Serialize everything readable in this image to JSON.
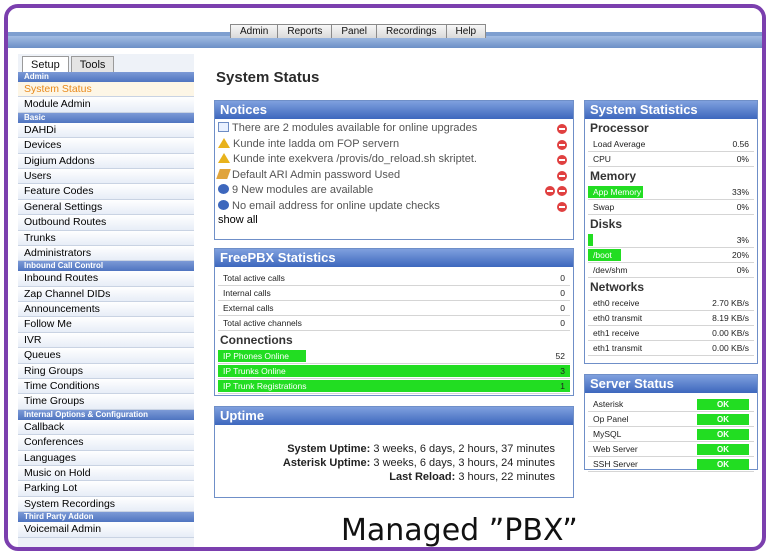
{
  "topnav": {
    "tabs": [
      "Admin",
      "Reports",
      "Panel",
      "Recordings",
      "Help"
    ]
  },
  "sidebar": {
    "tabs": [
      "Setup",
      "Tools"
    ],
    "sections": [
      {
        "header": "Admin",
        "items": [
          "System Status",
          "Module Admin"
        ]
      },
      {
        "header": "Basic",
        "items": [
          "DAHDi",
          "Devices",
          "Digium Addons",
          "Users",
          "Feature Codes",
          "General Settings",
          "Outbound Routes",
          "Trunks",
          "Administrators"
        ]
      },
      {
        "header": "Inbound Call Control",
        "items": [
          "Inbound Routes",
          "Zap Channel DIDs",
          "Announcements",
          "Follow Me",
          "IVR",
          "Queues",
          "Ring Groups",
          "Time Conditions",
          "Time Groups"
        ]
      },
      {
        "header": "Internal Options & Configuration",
        "items": [
          "Callback",
          "Conferences",
          "Languages",
          "Music on Hold",
          "Parking Lot",
          "System Recordings"
        ]
      },
      {
        "header": "Third Party Addon",
        "items": [
          "Voicemail Admin"
        ]
      }
    ]
  },
  "main": {
    "title": "System Status"
  },
  "notices": {
    "title": "Notices",
    "items": [
      {
        "icon": "update-box-icon",
        "text": "There are 2 modules available for online upgrades"
      },
      {
        "icon": "warning-icon",
        "text": "Kunde inte ladda om FOP servern"
      },
      {
        "icon": "warning-icon",
        "text": "Kunde inte exekvera /provis/do_reload.sh skriptet."
      },
      {
        "icon": "pencil-icon",
        "text": "Default ARI Admin password Used"
      },
      {
        "icon": "info-icon",
        "text": "9 New modules are available"
      },
      {
        "icon": "info-icon",
        "text": "No email address for online update checks"
      }
    ],
    "show_all": "show all"
  },
  "freepbx": {
    "title": "FreePBX Statistics",
    "rows": [
      {
        "label": "Total active calls",
        "value": "0"
      },
      {
        "label": "Internal calls",
        "value": "0"
      },
      {
        "label": "External calls",
        "value": "0"
      },
      {
        "label": "Total active channels",
        "value": "0"
      }
    ],
    "connections_label": "Connections",
    "connections": [
      {
        "label": "IP Phones Online",
        "value": "52",
        "fill": 0.25
      },
      {
        "label": "IP Trunks Online",
        "value": "3",
        "fill": 1
      },
      {
        "label": "IP Trunk Registrations",
        "value": "1",
        "fill": 1
      }
    ]
  },
  "uptime": {
    "title": "Uptime",
    "rows": [
      {
        "label": "System Uptime:",
        "value": "3 weeks, 6 days, 2 hours, 37 minutes"
      },
      {
        "label": "Asterisk Uptime:",
        "value": "3 weeks, 6 days, 3 hours, 24 minutes"
      },
      {
        "label": "Last Reload:",
        "value": "3 hours, 22 minutes"
      }
    ]
  },
  "system_stats": {
    "title": "System Statistics",
    "processor_label": "Processor",
    "processor": [
      {
        "label": "Load Average",
        "value": "0.56"
      },
      {
        "label": "CPU",
        "value": "0%"
      }
    ],
    "memory_label": "Memory",
    "memory": [
      {
        "label": "App Memory",
        "value": "33%",
        "fill": 0.33
      },
      {
        "label": "Swap",
        "value": "0%",
        "fill": 0
      }
    ],
    "disks_label": "Disks",
    "disks": [
      {
        "label": "",
        "value": "3%",
        "fill": 0.03
      },
      {
        "label": "/boot",
        "value": "20%",
        "fill": 0.2
      },
      {
        "label": "/dev/shm",
        "value": "0%",
        "fill": 0
      }
    ],
    "networks_label": "Networks",
    "networks": [
      {
        "label": "eth0 receive",
        "value": "2.70 KB/s"
      },
      {
        "label": "eth0 transmit",
        "value": "8.19 KB/s"
      },
      {
        "label": "eth1 receive",
        "value": "0.00 KB/s"
      },
      {
        "label": "eth1 transmit",
        "value": "0.00 KB/s"
      }
    ]
  },
  "server_status": {
    "title": "Server Status",
    "rows": [
      {
        "label": "Asterisk",
        "status": "OK"
      },
      {
        "label": "Op Panel",
        "status": "OK"
      },
      {
        "label": "MySQL",
        "status": "OK"
      },
      {
        "label": "Web Server",
        "status": "OK"
      },
      {
        "label": "SSH Server",
        "status": "OK"
      }
    ]
  },
  "caption": "Managed ”PBX”",
  "colors": {
    "frame": "#7b3fae",
    "panel_header": "#3d67bd",
    "bar": "#22dd22",
    "active_item": "#e8891a"
  }
}
